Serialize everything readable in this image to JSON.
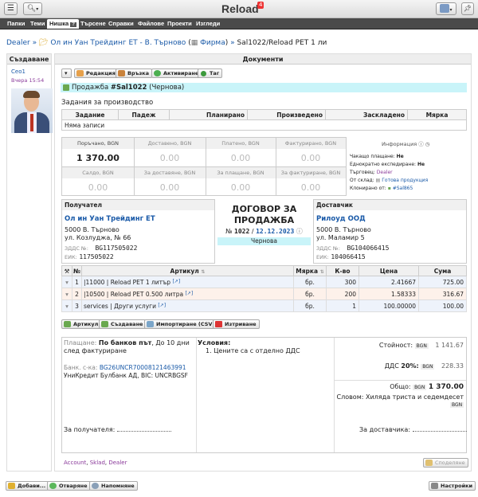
{
  "app": {
    "title": "Reload",
    "badge": "4"
  },
  "menu": [
    "Папки",
    "Теми",
    "Нишка",
    "Търсене",
    "Справки",
    "Файлове",
    "Проекти",
    "Изгледи"
  ],
  "menu_active_help": "?",
  "breadcrumb": {
    "root": "Dealer",
    "sep": "»",
    "company": "Ол ин Уан Трейдинг ЕТ - В. Търново",
    "firm_open": "(",
    "firm": "Фирма",
    "firm_close": ")",
    "doc": "Sal1022/Reload PET 1 ли"
  },
  "left": {
    "header": "Създаване",
    "user": "Ceo1",
    "time": "Вчера 15:54"
  },
  "main": {
    "header": "Документи",
    "toolbar": [
      "Редакция",
      "Връзка",
      "Активиране",
      "Таг"
    ],
    "title_prefix": "Продажба",
    "title_id": "#Sal1022",
    "title_status": "(Чернова)",
    "tasks_title": "Задания за производство",
    "tasks_cols": [
      "Задание",
      "Падеж",
      "Планирано",
      "Произведено",
      "Заскладено",
      "Мярка"
    ],
    "tasks_empty": "Няма записи",
    "totals": {
      "row1": [
        {
          "label": "Поръчано, BGN",
          "value": "1 370.00"
        },
        {
          "label": "Доставено, BGN",
          "value": "0.00"
        },
        {
          "label": "Платено, BGN",
          "value": "0.00"
        },
        {
          "label": "Фактурирано, BGN",
          "value": "0.00"
        }
      ],
      "row2": [
        {
          "label": "Салдо, BGN",
          "value": "0.00"
        },
        {
          "label": "За доставяне, BGN",
          "value": "0.00"
        },
        {
          "label": "За плащане, BGN",
          "value": "0.00"
        },
        {
          "label": "За фактуриране, BGN",
          "value": "0.00"
        }
      ]
    },
    "info": {
      "title": "Информация",
      "rows": [
        {
          "k": "Чакащо плащане:",
          "v": "Не"
        },
        {
          "k": "Еднократно експедиране:",
          "v": "Не"
        },
        {
          "k": "Търговец:",
          "v": "Dealer"
        },
        {
          "k": "От склад:",
          "v": "Готова продукция"
        },
        {
          "k": "Клонирано от:",
          "v": "#Sal865"
        }
      ]
    },
    "recipient": {
      "label": "Получател",
      "name": "Ол ин Уан Трейдинг ЕТ",
      "addr1": "5000 В. Търново",
      "addr2": "ул. Козлуджа, № 66",
      "vat_label": "ЗДДС №:",
      "vat": "BG117505022",
      "eik_label": "ЕИК:",
      "eik": "117505022"
    },
    "contract": {
      "title": "ДОГОВОР ЗА ПРОДАЖБА",
      "no_label": "№",
      "no": "1022",
      "sep": "/",
      "date": "12.12.2023",
      "status": "Чернова"
    },
    "supplier": {
      "label": "Доставчик",
      "name": "Рилоуд ООД",
      "addr1": "5000 В. Търново",
      "addr2": "ул. Маламир 5",
      "vat_label": "ЗДДС №:",
      "vat": "BG104066415",
      "eik_label": "ЕИК:",
      "eik": "104066415"
    },
    "items": {
      "cols": [
        "№",
        "Артикул",
        "Мярка",
        "К-во",
        "Цена",
        "Сума"
      ],
      "rows": [
        {
          "n": "1",
          "code": "11000",
          "name": "Reload PET 1 литър",
          "unit": "бр.",
          "qty": "300",
          "price": "2.41667",
          "sum": "725.00"
        },
        {
          "n": "2",
          "code": "10500",
          "name": "Reload PET 0.500 литра",
          "unit": "бр.",
          "qty": "200",
          "price": "1.58333",
          "sum": "316.67"
        },
        {
          "n": "3",
          "code": "services",
          "name": "Други услуги",
          "unit": "бр.",
          "qty": "1",
          "price": "100.00000",
          "sum": "100.00"
        }
      ]
    },
    "item_buttons": [
      "Артикул",
      "Създаване",
      "Импортиране (CSV)",
      "Изтриване"
    ],
    "payment": {
      "label": "Плащане:",
      "method": "По банков път",
      "terms": ", До 10 дни след фактуриране",
      "bank_label": "Банк. с-ка:",
      "iban": "BG26UNCR70008121463991",
      "bank": "УниКредит Булбанк АД, BIC: UNCRBGSF"
    },
    "conditions": {
      "title": "Условия:",
      "items": [
        "Цените са с отделно ДДС"
      ]
    },
    "summary": {
      "value_label": "Стойност:",
      "currency": "BGN",
      "value": "1 141.67",
      "vat_label": "ДДС",
      "vat_rate": "20%:",
      "vat": "228.33",
      "total_label": "Общо:",
      "total": "1 370.00",
      "words_label": "Словом:",
      "words": "Хиляда триста и седемдесет"
    },
    "sign": {
      "recipient": "За получателя:",
      "supplier": "За доставчика:"
    },
    "footer_links": [
      "Account",
      "Sklad",
      "Dealer"
    ],
    "share": "Споделяне"
  },
  "bottom": [
    "Добави...",
    "Отваряне",
    "Напомняне",
    "Настройки"
  ]
}
